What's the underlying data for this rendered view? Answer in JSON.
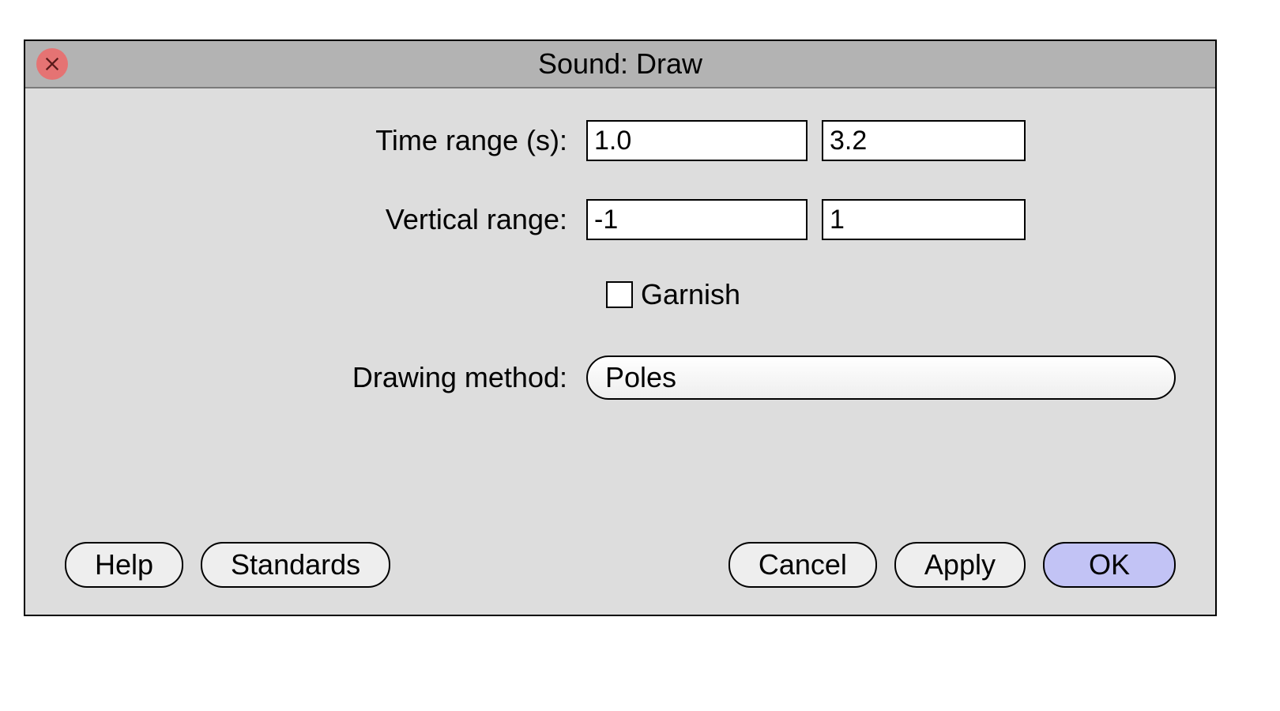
{
  "window": {
    "title": "Sound: Draw"
  },
  "fields": {
    "time_range_label": "Time range (s):",
    "time_range_start": "1.0",
    "time_range_end": "3.2",
    "vertical_range_label": "Vertical range:",
    "vertical_range_start": "-1",
    "vertical_range_end": "1",
    "garnish_label": "Garnish",
    "garnish_checked": false,
    "drawing_method_label": "Drawing method:",
    "drawing_method_value": "Poles"
  },
  "buttons": {
    "help": "Help",
    "standards": "Standards",
    "cancel": "Cancel",
    "apply": "Apply",
    "ok": "OK"
  }
}
